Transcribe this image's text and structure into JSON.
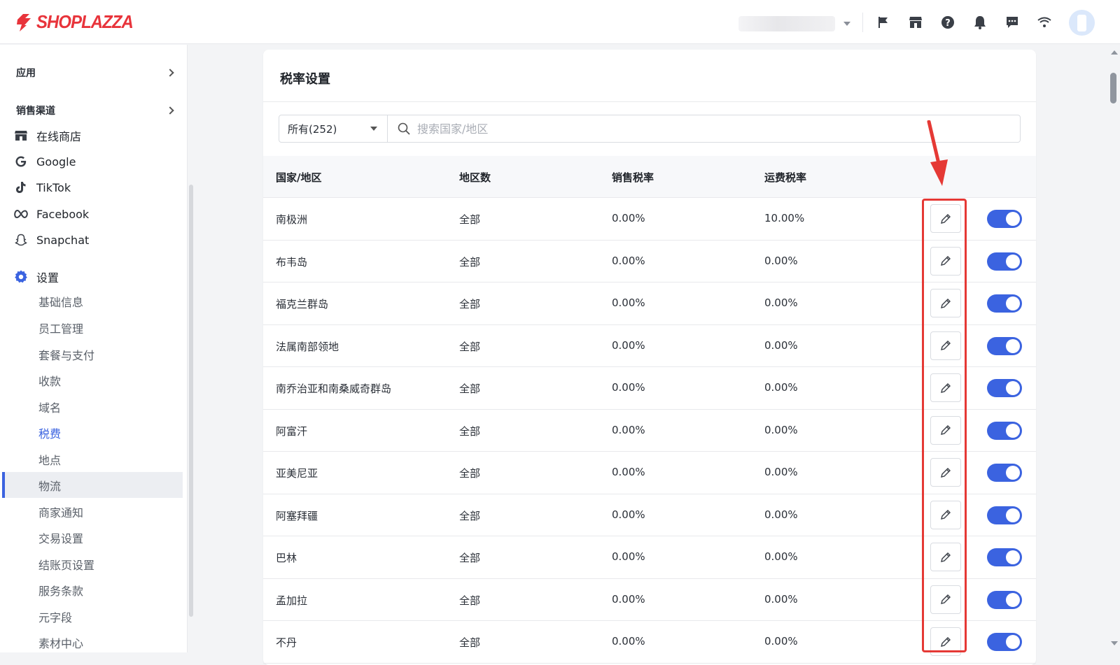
{
  "brand": {
    "logo_text": "SHOPLAZZA",
    "accent": "#e8343b"
  },
  "sidebar": {
    "sections": [
      {
        "label": "应用"
      },
      {
        "label": "销售渠道"
      }
    ],
    "channels": [
      {
        "label": "在线商店",
        "icon": "store-icon"
      },
      {
        "label": "Google",
        "icon": "google-icon"
      },
      {
        "label": "TikTok",
        "icon": "tiktok-icon"
      },
      {
        "label": "Facebook",
        "icon": "meta-icon"
      },
      {
        "label": "Snapchat",
        "icon": "snapchat-icon"
      }
    ],
    "settings": {
      "label": "设置",
      "icon": "gear-icon",
      "items": [
        "基础信息",
        "员工管理",
        "套餐与支付",
        "收款",
        "域名",
        "税费",
        "地点",
        "物流",
        "商家通知",
        "交易设置",
        "结账页设置",
        "服务条款",
        "元字段",
        "素材中心"
      ],
      "active": "税费"
    }
  },
  "page": {
    "title": "税率设置",
    "filter": {
      "selected": "所有(252)",
      "search_placeholder": "搜索国家/地区"
    },
    "columns": [
      "国家/地区",
      "地区数",
      "销售税率",
      "运费税率"
    ],
    "rows": [
      {
        "country": "南极洲",
        "regions": "全部",
        "sales_tax": "0.00%",
        "shipping_tax": "10.00%",
        "enabled": true
      },
      {
        "country": "布韦岛",
        "regions": "全部",
        "sales_tax": "0.00%",
        "shipping_tax": "0.00%",
        "enabled": true
      },
      {
        "country": "福克兰群岛",
        "regions": "全部",
        "sales_tax": "0.00%",
        "shipping_tax": "0.00%",
        "enabled": true
      },
      {
        "country": "法属南部领地",
        "regions": "全部",
        "sales_tax": "0.00%",
        "shipping_tax": "0.00%",
        "enabled": true
      },
      {
        "country": "南乔治亚和南桑威奇群岛",
        "regions": "全部",
        "sales_tax": "0.00%",
        "shipping_tax": "0.00%",
        "enabled": true
      },
      {
        "country": "阿富汗",
        "regions": "全部",
        "sales_tax": "0.00%",
        "shipping_tax": "0.00%",
        "enabled": true
      },
      {
        "country": "亚美尼亚",
        "regions": "全部",
        "sales_tax": "0.00%",
        "shipping_tax": "0.00%",
        "enabled": true
      },
      {
        "country": "阿塞拜疆",
        "regions": "全部",
        "sales_tax": "0.00%",
        "shipping_tax": "0.00%",
        "enabled": true
      },
      {
        "country": "巴林",
        "regions": "全部",
        "sales_tax": "0.00%",
        "shipping_tax": "0.00%",
        "enabled": true
      },
      {
        "country": "孟加拉",
        "regions": "全部",
        "sales_tax": "0.00%",
        "shipping_tax": "0.00%",
        "enabled": true
      },
      {
        "country": "不丹",
        "regions": "全部",
        "sales_tax": "0.00%",
        "shipping_tax": "0.00%",
        "enabled": true
      }
    ]
  },
  "colors": {
    "primary": "#3b63e0",
    "annotation": "#e53935"
  }
}
